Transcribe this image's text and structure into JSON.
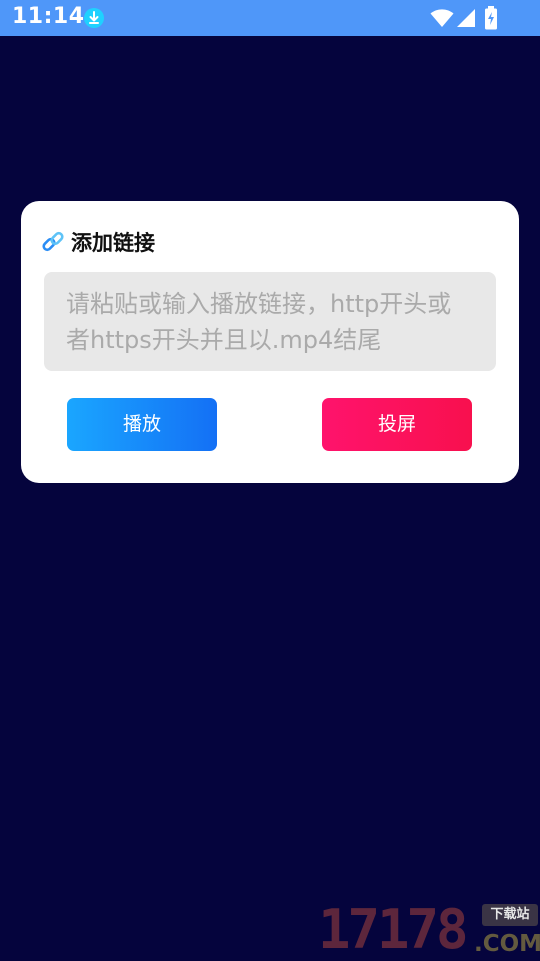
{
  "status_bar": {
    "time": "11:14",
    "icons": [
      "download-icon",
      "wifi-icon",
      "signal-icon",
      "battery-charging-icon"
    ],
    "background_color": "#4f97f9"
  },
  "dialog": {
    "title": "添加链接",
    "title_icon": "link-icon",
    "input": {
      "value": "",
      "placeholder": "请粘贴或输入播放链接，http开头或者https开头并且以.mp4结尾"
    },
    "buttons": {
      "play_label": "播放",
      "cast_label": "投屏"
    }
  },
  "watermark": {
    "digits": "17178",
    "badge": "下载站",
    "domain": ".COM"
  },
  "colors": {
    "page_background": "#05043d",
    "play_button": "#1a8cfb",
    "cast_button": "#fc1260",
    "input_background": "#e8e8e8"
  }
}
